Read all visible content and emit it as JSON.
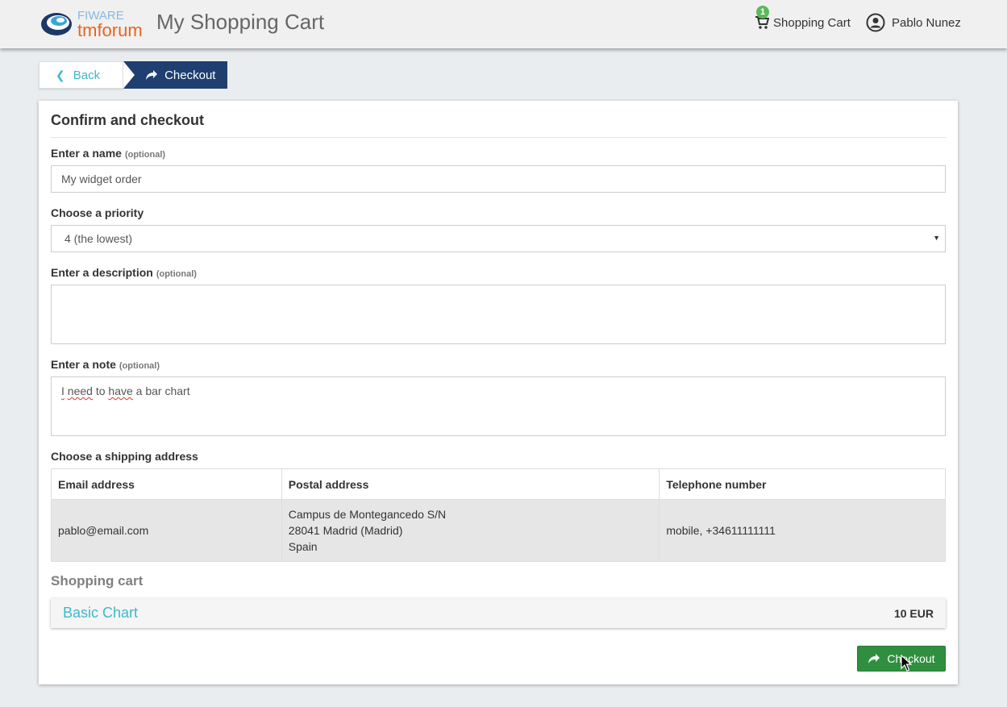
{
  "header": {
    "logo_top": "FIWARE",
    "logo_bottom": "tmforum",
    "title": "My Shopping Cart",
    "cart_label": "Shopping Cart",
    "cart_count": "1",
    "user_name": "Pablo Nunez"
  },
  "nav": {
    "back_label": "Back",
    "checkout_label": "Checkout"
  },
  "form": {
    "title": "Confirm and checkout",
    "optional": "(optional)",
    "name_label": "Enter a name",
    "name_value": "My widget order",
    "priority_label": "Choose a priority",
    "priority_value": "4 (the lowest)",
    "description_label": "Enter a description",
    "description_value": "",
    "note_label": "Enter a note",
    "note_word1": "I",
    "note_word2": "need",
    "note_word3": "to",
    "note_word4": "have",
    "note_rest": "a bar chart",
    "shipping_label": "Choose a shipping address"
  },
  "address_table": {
    "headers": [
      "Email address",
      "Postal address",
      "Telephone number"
    ],
    "row": {
      "email": "pablo@email.com",
      "postal_line1": "Campus de Montegancedo S/N",
      "postal_line2": "28041 Madrid (Madrid)",
      "postal_line3": "Spain",
      "phone": "mobile, +34611111111"
    }
  },
  "cart": {
    "heading": "Shopping cart",
    "items": [
      {
        "name": "Basic Chart",
        "price": "10 EUR"
      }
    ],
    "checkout_label": "Checkout"
  },
  "colors": {
    "accent": "#3eb8cc",
    "nav_dark": "#1e3f6f",
    "success": "#2f8f3f"
  }
}
